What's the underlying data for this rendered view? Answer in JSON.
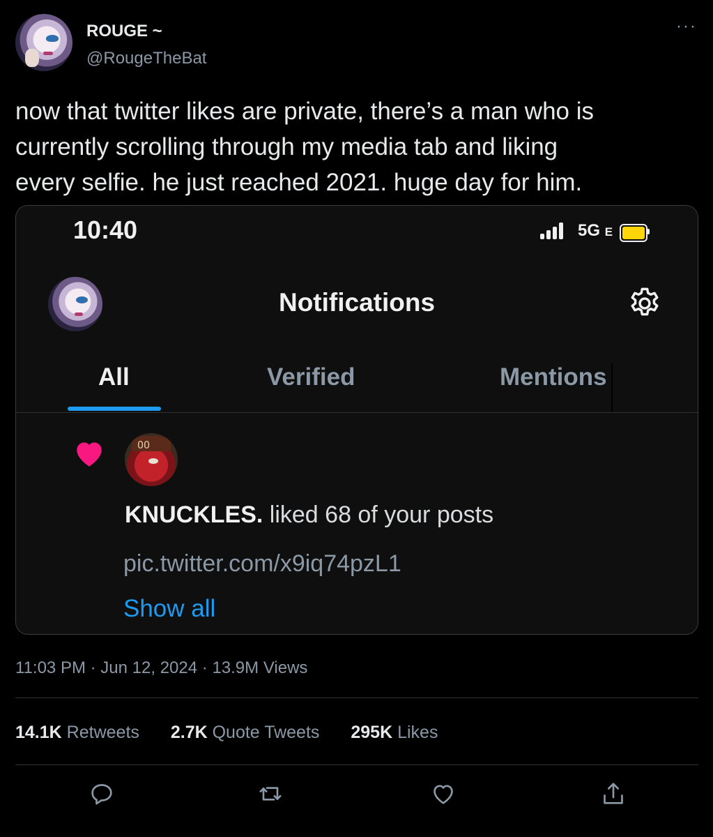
{
  "author": {
    "display_name": "ROUGE ~",
    "handle": "@RougeTheBat",
    "avatar_icon": "rouge-avatar"
  },
  "more_label": "···",
  "tweet": {
    "text_lines": [
      "now that twitter likes are private, there’s a man who is",
      "currently scrolling through my media tab and liking",
      "every selfie. he just reached 2021. huge day for him."
    ]
  },
  "screenshot": {
    "status_bar": {
      "time": "10:40",
      "network": "5G",
      "network_suffix": "E",
      "battery_color": "#ffd60a"
    },
    "title": "Notifications",
    "settings_icon": "gear-icon",
    "tabs": [
      {
        "label": "All",
        "active": true
      },
      {
        "label": "Verified",
        "active": false
      },
      {
        "label": "Mentions",
        "active": false
      }
    ],
    "accent": "#1d9bf0",
    "notification": {
      "icon": "heart-icon",
      "icon_color": "#f91880",
      "user": "KNUCKLES.",
      "action": " liked 68 of your posts",
      "link": "pic.twitter.com/x9iq74pzL1",
      "show_all": "Show all"
    }
  },
  "meta": {
    "time": "11:03 PM",
    "sep": "·",
    "date": "Jun 12, 2024",
    "views_count": "13.9M",
    "views_label": "Views"
  },
  "stats": [
    {
      "value": "14.1K",
      "label": "Retweets"
    },
    {
      "value": "2.7K",
      "label": "Quote Tweets"
    },
    {
      "value": "295K",
      "label": "Likes"
    }
  ],
  "actions": [
    "reply-icon",
    "retweet-icon",
    "like-icon",
    "share-icon"
  ]
}
